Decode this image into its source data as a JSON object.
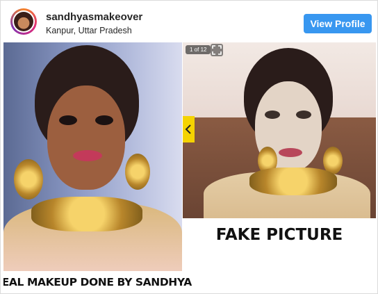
{
  "header": {
    "username": "sandhyasmakeover",
    "location": "Kanpur, Uttar Pradesh",
    "view_profile_label": "View Profile",
    "avatar_icon": "profile-photo"
  },
  "media": {
    "counter": "1 of 12",
    "expand_icon": "expand-icon",
    "prev_icon": "chevron-left-icon",
    "left_caption": "REAL MAKEUP DONE BY SANDHYA",
    "right_caption": "FAKE PICTURE"
  },
  "colors": {
    "button_blue": "#3897f0",
    "nav_yellow": "#f5d300"
  }
}
